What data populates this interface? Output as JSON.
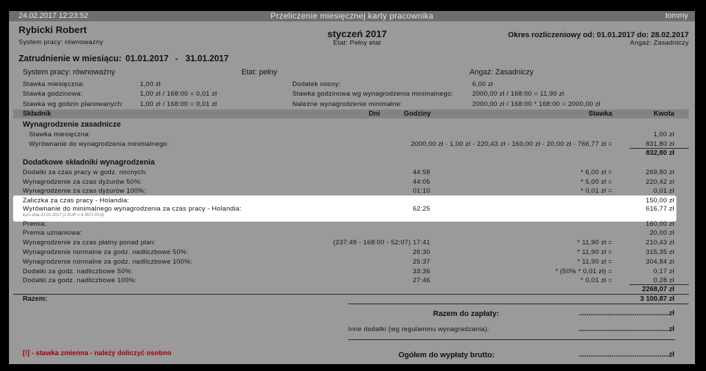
{
  "titlebar": {
    "datetime": "24.02.2017  12:23:52",
    "title": "Przeliczenie miesięcznej karty pracownika",
    "user": "tommy"
  },
  "employee": {
    "name": "Rybicki Robert",
    "system": "System pracy: równoważny"
  },
  "month": {
    "label": "styczeń 2017",
    "etat": "Etat: Pełny etat"
  },
  "period": {
    "label": "Okres rozliczeniowy od: 01.01.2017 do: 28.02.2017",
    "angaz": "Angaż: Zasadniczy"
  },
  "employment": {
    "label": "Zatrudnienie w miesiącu:",
    "from": "01.01.2017",
    "dash": "-",
    "to": "31.01.2017"
  },
  "info": {
    "system": "System pracy: równoważny",
    "etat": "Etat: pełny",
    "angaz": "Angaż: Zasadniczy",
    "left": [
      {
        "label": "Stawka miesięczna:",
        "value": "1,00 zł"
      },
      {
        "label": "Stawka godzinowa:",
        "value": "1,00 zł / 168:00 = 0,01 zł"
      },
      {
        "label": "Stawka wg godzin planowanych:",
        "value": "1,00 zł / 168:00 = 0,01 zł"
      }
    ],
    "right": [
      {
        "label": "Dodatek nocny:",
        "value": "6,00 zł"
      },
      {
        "label": "Stawka godzinowa wg wynagrodzenia minimalnego:",
        "value": "2000,00 zł / 168:00 = 11,90 zł"
      },
      {
        "label": "Należne wynagrodzenie minimalne:",
        "value": "2000,00 zł / 168:00 * 168:00 = 2000,00 zł"
      }
    ]
  },
  "table_header": {
    "skladnik": "Składnik",
    "dni": "Dni",
    "godziny": "Godziny",
    "stawka": "Stawka",
    "kwota": "Kwota"
  },
  "section1": {
    "title": "Wynagrodzenie zasadnicze",
    "rows": [
      {
        "label": "Stawka miesięczna:",
        "godziny": "",
        "stawka": "",
        "kwota": "1,00 zł"
      },
      {
        "label": "Wyrównanie do wynagrodzenia minimalnego:",
        "godziny": "2000,00 zł - 1,00 zł - 220,43 zł - 160,00 zł - 20,00 zł - 766,77 zł =",
        "stawka": "",
        "kwota": "831,80 zł"
      }
    ],
    "subtotal": "832,80 zł"
  },
  "section2": {
    "title": "Dodatkowe składniki wynagrodzenia",
    "rows": [
      {
        "label": "Dodatki za czas pracy w godz. nocnych:",
        "godziny": "44:58",
        "stawka": "* 6,00 zł =",
        "kwota": "269,80 zł"
      },
      {
        "label": "Wynagrodzenie za czas dyżurów 50%:",
        "godziny": "44:05",
        "stawka": "* 5,00 zł =",
        "kwota": "220,42 zł"
      },
      {
        "label": "Wynagrodzenie za czas dyżurów 100%:",
        "godziny": "01:10",
        "stawka": "* 0,01 zł =",
        "kwota": "0,01 zł"
      }
    ],
    "highlight": {
      "row1": {
        "label": "Zaliczka za czas pracy - Holandia:",
        "kwota": "150,00 zł"
      },
      "row2": {
        "label": "Wyrównanie do minimalnego wynagrodzenia za czas pracy - Holandia:",
        "godziny": "62:25",
        "kwota": "616,77 zł"
      },
      "note": "kurs dnia 01.01.2017 (1 EUR = 4,3571 PLN)"
    },
    "rows2": [
      {
        "label": "Premia:",
        "godziny": "",
        "stawka": "",
        "kwota": "160,00 zł"
      },
      {
        "label": "Premia uznaniowa:",
        "godziny": "",
        "stawka": "",
        "kwota": "20,00 zł"
      },
      {
        "label": "Wynagrodzenie za czas płatny ponad plan:",
        "godziny": "(237:48 - 168:00 - 52:07) 17:41",
        "stawka": "* 11,90 zł =",
        "kwota": "210,43 zł"
      },
      {
        "label": "Wynagrodzenie normalne za godz. nadliczbowe 50%:",
        "godziny": "26:30",
        "stawka": "* 11,90 zł =",
        "kwota": "315,35 zł"
      },
      {
        "label": "Wynagrodzenie normalne za godz. nadliczbowe 100%:",
        "godziny": "25:37",
        "stawka": "* 11,90 zł =",
        "kwota": "304,84 zł"
      },
      {
        "label": "Dodatki za godz. nadliczbowe 50%:",
        "godziny": "33:36",
        "stawka": "* (50% * 0,01 zł) =",
        "kwota": "0,17 zł"
      },
      {
        "label": "Dodatki za godz. nadliczbowe 100%:",
        "godziny": "27:46",
        "stawka": "* 0,01 zł =",
        "kwota": "0,28 zł"
      }
    ],
    "subtotal": "2268,07 zł"
  },
  "razem": {
    "label": "Razem:",
    "value": "3 100,87 zł"
  },
  "footer": {
    "razem_zaplaty": "Razem do zapłaty:",
    "razem_zaplaty_val": "...............................................zł",
    "inne": "Inne dodatki (wg regulaminu wynagradzania):",
    "inne_val": "...............................................zł",
    "ogolem": "Ogółem do wypłaty brutto:",
    "ogolem_val": "...............................................zł",
    "warning": "[!] - stawka zmienna - należy doliczyć osobno"
  }
}
